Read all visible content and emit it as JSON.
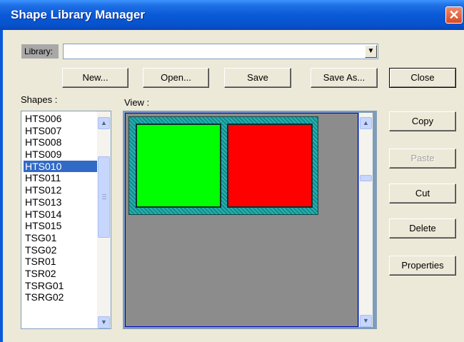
{
  "window": {
    "title": "Shape Library Manager",
    "close_glyph": "✕"
  },
  "library": {
    "label": "Library:",
    "value": "",
    "dropdown_glyph": "▼"
  },
  "toolbar": {
    "new_label": "New...",
    "open_label": "Open...",
    "save_label": "Save",
    "save_as_label": "Save As...",
    "close_label": "Close"
  },
  "shapes": {
    "label": "Shapes :",
    "items": [
      "HTS006",
      "HTS007",
      "HTS008",
      "HTS009",
      "HTS010",
      "HTS011",
      "HTS012",
      "HTS013",
      "HTS014",
      "HTS015",
      "TSG01",
      "TSG02",
      "TSR01",
      "TSR02",
      "TSRG01",
      "TSRG02"
    ],
    "selected": "HTS010",
    "scroll_up_glyph": "▲",
    "scroll_down_glyph": "▼"
  },
  "view": {
    "label": "View :",
    "shape_colors": {
      "frame": "#1a9a9a",
      "left": "#00ff00",
      "right": "#ff0000",
      "background": "#8c8c8c"
    }
  },
  "actions": {
    "copy_label": "Copy",
    "paste_label": "Paste",
    "cut_label": "Cut",
    "delete_label": "Delete",
    "properties_label": "Properties"
  }
}
